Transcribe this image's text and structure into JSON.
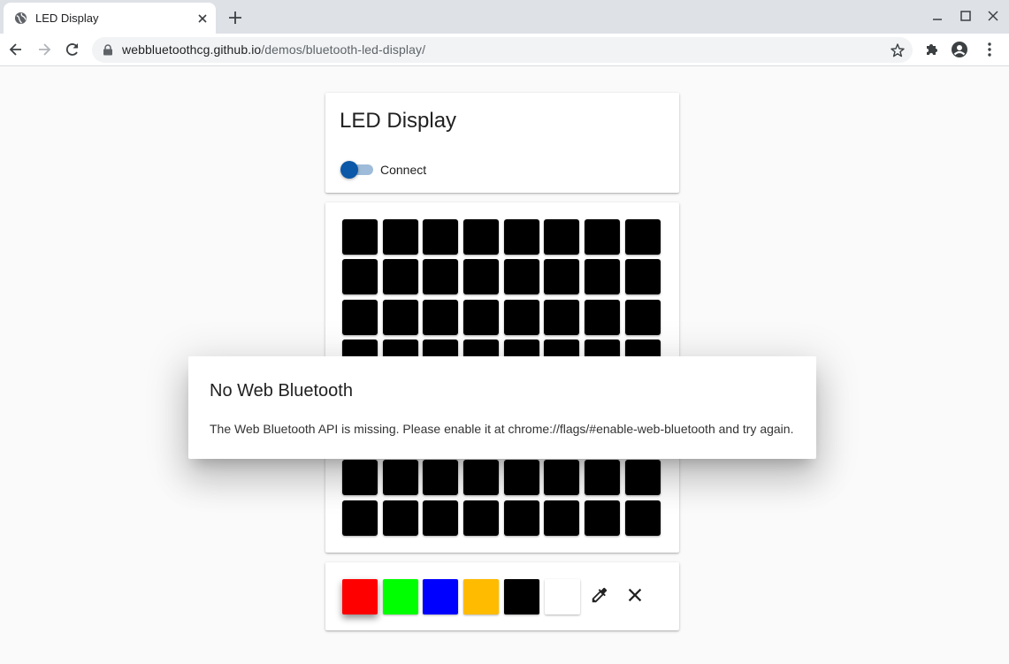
{
  "browser": {
    "tab_title": "LED Display",
    "url_host": "webbluetoothcg.github.io",
    "url_path": "/demos/bluetooth-led-display/"
  },
  "app": {
    "title": "LED Display",
    "connect_label": "Connect",
    "connected": false,
    "accent_color": "#0b57a8"
  },
  "led_grid": {
    "rows": 8,
    "cols": 8,
    "cell_color": "#000000"
  },
  "palette": {
    "colors": [
      "#ff0000",
      "#00ff00",
      "#0000ff",
      "#ffbb00",
      "#000000",
      "#ffffff"
    ],
    "selected_index": 0,
    "tools": [
      "eyedropper-icon",
      "clear-icon"
    ]
  },
  "dialog": {
    "title": "No Web Bluetooth",
    "message": "The Web Bluetooth API is missing. Please enable it at chrome://flags/#enable-web-bluetooth and try again."
  }
}
